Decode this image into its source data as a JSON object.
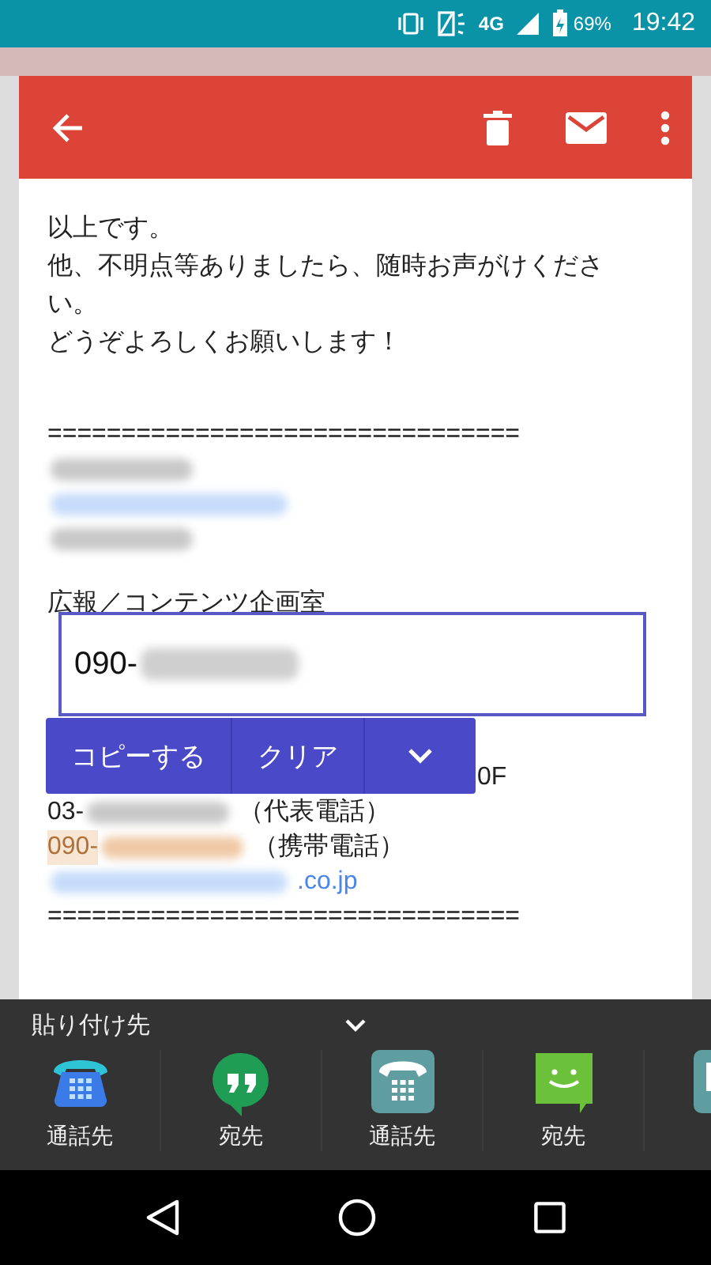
{
  "status_bar": {
    "network": "4G",
    "battery": "69%",
    "time": "19:42"
  },
  "message": {
    "paragraphs": [
      [
        [
          {
            "kind": "text",
            "text": "以上です。"
          }
        ],
        [
          {
            "kind": "text",
            "text": "他、不明点等ありましたら、随時お声がけくださ"
          }
        ],
        [
          {
            "kind": "text",
            "text": "い。"
          }
        ],
        [
          {
            "kind": "text",
            "text": "どうぞよろしくお願いします！"
          }
        ]
      ],
      [
        [
          {
            "kind": "text",
            "text": "================================"
          }
        ],
        [
          {
            "kind": "redacted"
          }
        ],
        [
          {
            "kind": "redacted_link"
          }
        ],
        [
          {
            "kind": "redacted"
          }
        ]
      ],
      [
        [
          {
            "kind": "text",
            "text": "広報／コンテンツ企画室"
          }
        ],
        [
          {
            "kind": "covered"
          }
        ],
        [
          {
            "kind": "covered"
          }
        ],
        [
          {
            "kind": "covered"
          }
        ],
        [
          {
            "kind": "covered"
          }
        ],
        [
          {
            "kind": "covered"
          },
          {
            "kind": "text",
            "text": "0F"
          }
        ],
        [
          {
            "kind": "text",
            "text": "03-"
          },
          {
            "kind": "redacted"
          },
          {
            "kind": "text",
            "text": "（代表電話）"
          }
        ],
        [
          {
            "kind": "highlight",
            "text": "090-"
          },
          {
            "kind": "redacted_highlight"
          },
          {
            "kind": "text",
            "text": "（携帯電話）"
          }
        ],
        [
          {
            "kind": "redacted_link"
          },
          {
            "kind": "link",
            "text": ".co.jp"
          }
        ],
        [
          {
            "kind": "text",
            "text": "================================"
          }
        ]
      ]
    ]
  },
  "selection_popup": {
    "value": "090-",
    "redacted": true,
    "actions": [
      "コピーする",
      "クリア"
    ]
  },
  "paste_sheet": {
    "title": "貼り付け先",
    "apps": [
      {
        "kind": "phone",
        "label": "通話先"
      },
      {
        "kind": "quotes",
        "label": "宛先"
      },
      {
        "kind": "phonetile",
        "label": "通話先"
      },
      {
        "kind": "smiley",
        "label": "宛先"
      },
      {
        "kind": "bubble"
      }
    ]
  }
}
